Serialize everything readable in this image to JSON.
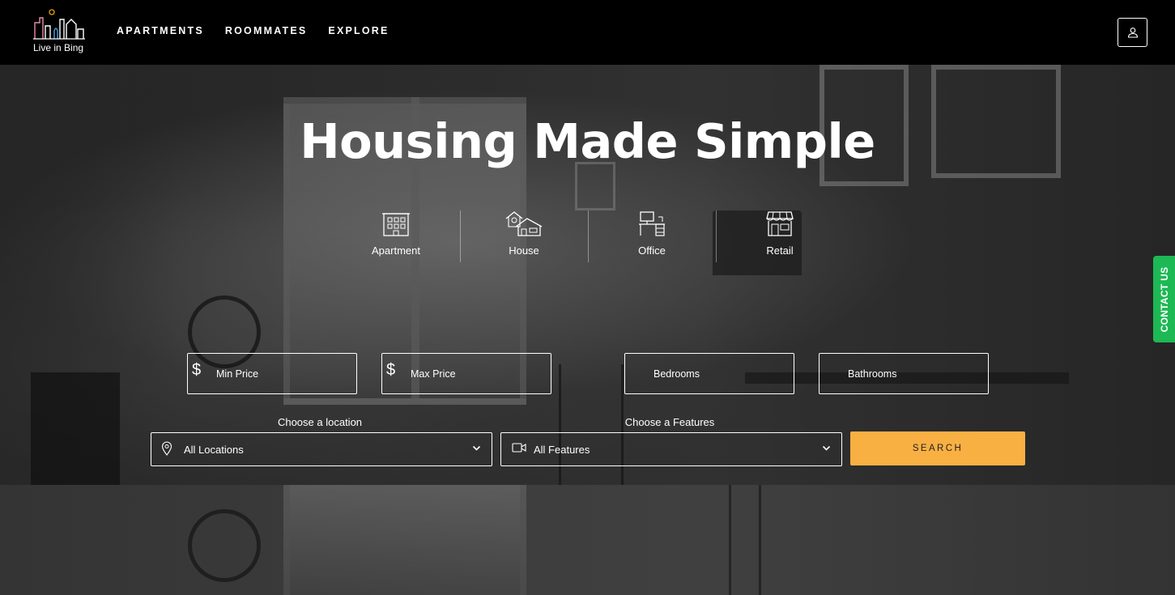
{
  "brand": {
    "logo_text": "Live in Bing",
    "logo_icon": "city-skyline-icon"
  },
  "nav": {
    "items": [
      "APARTMENTS",
      "ROOMMATES",
      "EXPLORE"
    ]
  },
  "header": {
    "user_icon": "user-icon"
  },
  "hero": {
    "title": "Housing Made Simple",
    "property_types": [
      {
        "label": "Apartment",
        "icon": "apartment-icon"
      },
      {
        "label": "House",
        "icon": "house-icon"
      },
      {
        "label": "Office",
        "icon": "office-icon"
      },
      {
        "label": "Retail",
        "icon": "retail-icon"
      }
    ]
  },
  "filters": {
    "currency_symbol": "$",
    "min_price_placeholder": "Min Price",
    "max_price_placeholder": "Max Price",
    "bedrooms_placeholder": "Bedrooms",
    "bathrooms_placeholder": "Bathrooms",
    "location_label": "Choose a location",
    "location_value": "All Locations",
    "features_label": "Choose a Features",
    "features_value": "All Features",
    "search_label": "SEARCH"
  },
  "contact": {
    "label": "CONTACT US"
  },
  "colors": {
    "accent": "#f9b043",
    "contact": "#1db954",
    "topbar": "#000000"
  }
}
